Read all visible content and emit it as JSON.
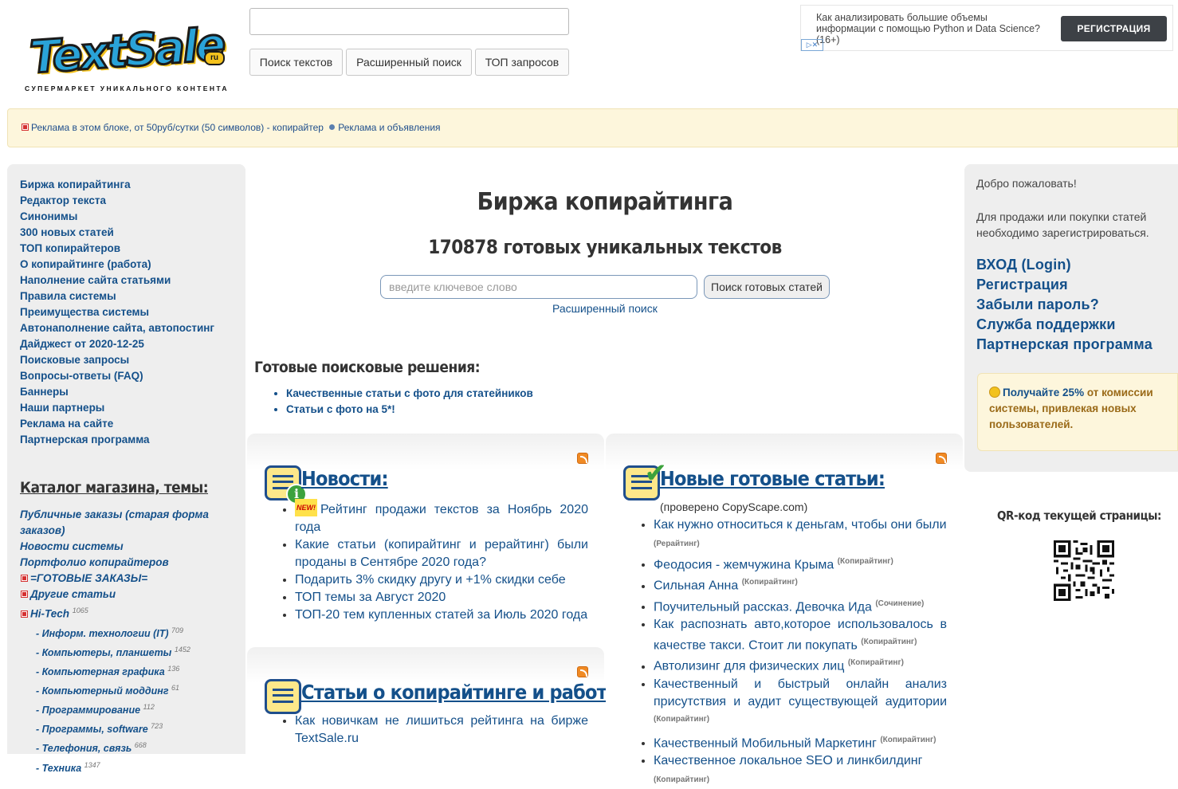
{
  "header": {
    "logo_text": "TextSale",
    "logo_badge": "ru",
    "logo_tagline": "СУПЕРМАРКЕТ УНИКАЛЬНОГО КОНТЕНТА",
    "search_value": "",
    "buttons": [
      "Поиск текстов",
      "Расширенный поиск",
      "ТОП запросов"
    ]
  },
  "ad_box": {
    "text": "Как анализировать большие объемы информации с помощью Python и Data Science? (16+)",
    "button": "РЕГИСТРАЦИЯ",
    "choice_icon": "ad-choices-icon"
  },
  "ad_strip": {
    "link1": "Реклама в этом блоке, от 50руб/сутки (50 символов) - копирайтер",
    "link2": "Реклама и объявления"
  },
  "left_nav": [
    "Биржа копирайтинга",
    "Редактор текста",
    "Синонимы",
    "300 новых статей",
    "ТОП копирайтеров",
    "О копирайтинге (работа)",
    "Наполнение сайта статьями",
    "Правила системы",
    "Преимущества системы",
    "Автонаполнение сайта, автопостинг",
    "Дайджест от 2020-12-25",
    "Поисковые запросы",
    "Вопросы-ответы (FAQ)",
    "Баннеры",
    "Наши партнеры",
    "Реклама на сайте",
    "Партнерская программа"
  ],
  "catalog": {
    "title": "Каталог магазина, темы:",
    "items": [
      "Публичные заказы (старая форма заказов)",
      "Новости системы",
      "Портфолио копирайтеров"
    ],
    "categories": [
      {
        "label": "=ГОТОВЫЕ ЗАКАЗЫ=",
        "count": ""
      },
      {
        "label": "Другие статьи",
        "count": ""
      },
      {
        "label": "Hi-Tech",
        "count": "1065"
      }
    ],
    "subcategories": [
      {
        "label": "- Информ. технологии (IT)",
        "count": "709"
      },
      {
        "label": "- Компьютеры, планшеты",
        "count": "1452"
      },
      {
        "label": "- Компьютерная графика",
        "count": "136"
      },
      {
        "label": "- Компьютерный моддинг",
        "count": "61"
      },
      {
        "label": "- Программирование",
        "count": "112"
      },
      {
        "label": "- Программы, software",
        "count": "723"
      },
      {
        "label": "- Телефония, связь",
        "count": "668"
      },
      {
        "label": "- Техника",
        "count": "1347"
      }
    ]
  },
  "main": {
    "title": "Биржа копирайтинга",
    "subtitle": "170878 готовых уникальных текстов",
    "search_placeholder": "введите ключевое слово",
    "search_button": "Поиск готовых статей",
    "advanced_link": "Расширенный поиск",
    "ready_title": "Готовые поисковые решения:",
    "ready_items": [
      "Качественные статьи с фото для статейников",
      "Статьи с фото на 5*!"
    ]
  },
  "news": {
    "title": "Новости:",
    "new_badge": "NEW!",
    "items": [
      "Рейтинг продажи текстов за Ноябрь 2020 года",
      "Какие статьи (копирайтинг и рерайтинг) были проданы в Сентябре 2020 года?",
      "Подарить 3% скидку другу и +1% скидки себе",
      "ТОП темы за Август 2020",
      "ТОП-20 тем купленных статей за Июль 2020 года"
    ]
  },
  "articles": {
    "title": "Статьи о копирайтинге и работе:",
    "items": [
      "Как новичкам не лишиться рейтинга на бирже TextSale.ru"
    ]
  },
  "new_texts": {
    "title": "Новые готовые статьи:",
    "note": "(проверено CopyScape.com)",
    "items": [
      {
        "label": "Как нужно относиться к деньгам, чтобы они были",
        "tag": "(Рерайтинг)"
      },
      {
        "label": "Феодосия - жемчужина Крыма",
        "tag": "(Копирайтинг)"
      },
      {
        "label": "Сильная Анна",
        "tag": "(Копирайтинг)"
      },
      {
        "label": "Поучительный рассказ. Девочка Ида",
        "tag": "(Сочинение)"
      },
      {
        "label": "Как распознать авто,которое использовалось в качестве такси. Стоит ли покупать",
        "tag": "(Копирайтинг)"
      },
      {
        "label": "Автолизинг для физических лиц",
        "tag": "(Копирайтинг)"
      },
      {
        "label": "Качественный и быстрый онлайн анализ присутствия и аудит существующей аудитории",
        "tag": "(Копирайтинг)"
      },
      {
        "label": "Качественный Мобильный Маркетинг",
        "tag": "(Копирайтинг)"
      },
      {
        "label": "Качественное локальное SEO и линкбилдинг",
        "tag": "(Копирайтинг)"
      }
    ]
  },
  "right": {
    "welcome": "Добро пожаловать!",
    "register_note": "Для продажи или покупки статей необходимо зарегистрироваться.",
    "links": [
      "ВХОД (Login)",
      "Регистрация",
      "Забыли пароль?",
      "Служба поддержки",
      "Партнерская программа"
    ],
    "promo_pre": "Получайте ",
    "promo_hl": "25%",
    "promo_post": " от комиссии системы, привлекая новых пользователей.",
    "qr_title": "QR-код текущей страницы:"
  },
  "colors": {
    "link": "#14508a",
    "ad_strip_bg": "#fdf6dc",
    "sidebar_bg": "#eeeeee",
    "register_button_bg": "#3d4146"
  }
}
